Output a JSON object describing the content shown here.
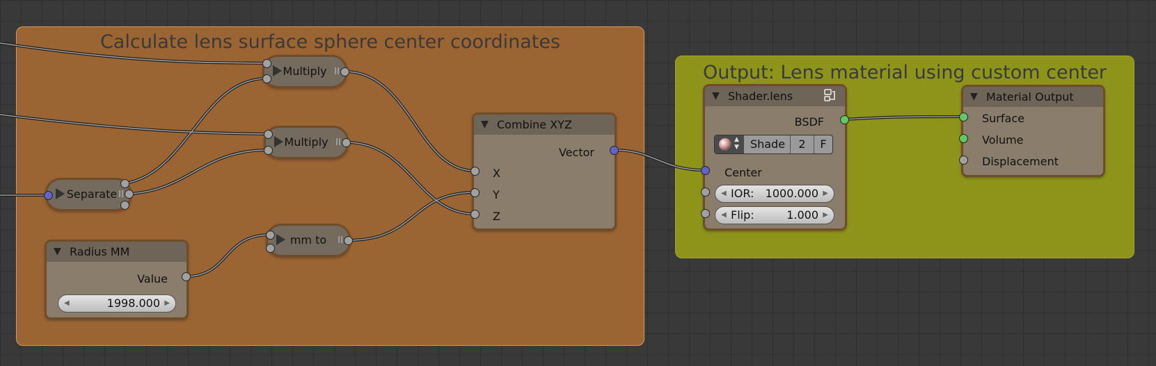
{
  "frames": {
    "calc_title": "Calculate lens surface sphere center coordinates",
    "output_title": "Output: Lens material using custom center"
  },
  "nodes": {
    "multiply1": {
      "label": "Multiply"
    },
    "multiply2": {
      "label": "Multiply"
    },
    "separate": {
      "label": "Separate"
    },
    "mm_to": {
      "label": "mm to"
    },
    "radius": {
      "title": "Radius MM",
      "output": "Value",
      "value": "1998.000"
    },
    "combine": {
      "title": "Combine XYZ",
      "output": "Vector",
      "inputs": [
        "X",
        "Y",
        "Z"
      ]
    },
    "shader": {
      "title": "Shader.lens",
      "output": "BSDF",
      "datablock_name": "Shade",
      "users": "2",
      "fake_user": "F",
      "center_label": "Center",
      "ior_label": "IOR:",
      "ior_value": "1000.000",
      "flip_label": "Flip:",
      "flip_value": "1.000"
    },
    "material_output": {
      "title": "Material Output",
      "inputs": [
        "Surface",
        "Volume",
        "Displacement"
      ]
    }
  },
  "colors": {
    "background": "#393939",
    "frame_calc": "#9a6433",
    "frame_output": "#8e931a",
    "socket_float": "#a1a1a1",
    "socket_vector": "#6363c7",
    "socket_shader": "#63c763"
  }
}
